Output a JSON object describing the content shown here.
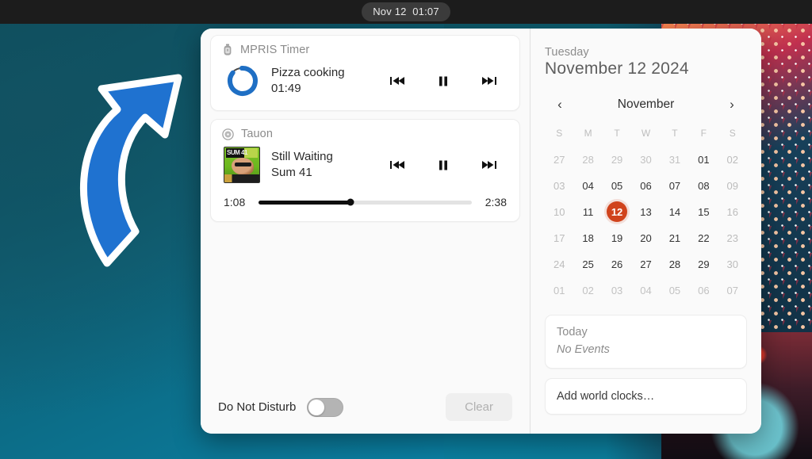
{
  "topbar": {
    "clock": "Nov 12  01:07"
  },
  "notifications": {
    "groups": [
      {
        "app_name": "MPRIS Timer",
        "app_icon": "stopwatch-icon",
        "thumb": "timer-ring",
        "title": "Pizza cooking",
        "subtitle": "01:49",
        "controls": [
          {
            "name": "previous",
            "glyph": "⏮"
          },
          {
            "name": "pause",
            "glyph": "⏸"
          },
          {
            "name": "next",
            "glyph": "⏭"
          }
        ],
        "ring_progress_percent": 72,
        "ring_color": "#1f6fc4"
      },
      {
        "app_name": "Tauon",
        "app_icon": "disc-icon",
        "thumb": "album-art",
        "title": "Still Waiting",
        "subtitle": "Sum 41",
        "album_art_text": "SUM 41",
        "controls": [
          {
            "name": "previous",
            "glyph": "⏮"
          },
          {
            "name": "pause",
            "glyph": "⏸"
          },
          {
            "name": "next",
            "glyph": "⏭"
          }
        ],
        "seek": {
          "elapsed": "1:08",
          "total": "2:38",
          "progress_percent": 43
        }
      }
    ]
  },
  "footer": {
    "dnd_label": "Do Not Disturb",
    "dnd_on": false,
    "clear_label": "Clear"
  },
  "calendar": {
    "weekday": "Tuesday",
    "full_date": "November 12 2024",
    "month_label": "November",
    "prev_glyph": "‹",
    "next_glyph": "›",
    "dow_labels": [
      "S",
      "M",
      "T",
      "W",
      "T",
      "F",
      "S"
    ],
    "weeks": [
      [
        {
          "n": "27",
          "state": "dim"
        },
        {
          "n": "28",
          "state": "dim"
        },
        {
          "n": "29",
          "state": "dim"
        },
        {
          "n": "30",
          "state": "dim"
        },
        {
          "n": "31",
          "state": "dim"
        },
        {
          "n": "01",
          "state": "normal"
        },
        {
          "n": "02",
          "state": "weekend"
        }
      ],
      [
        {
          "n": "03",
          "state": "weekend"
        },
        {
          "n": "04",
          "state": "normal"
        },
        {
          "n": "05",
          "state": "normal"
        },
        {
          "n": "06",
          "state": "normal"
        },
        {
          "n": "07",
          "state": "normal"
        },
        {
          "n": "08",
          "state": "normal"
        },
        {
          "n": "09",
          "state": "weekend"
        }
      ],
      [
        {
          "n": "10",
          "state": "weekend"
        },
        {
          "n": "11",
          "state": "normal"
        },
        {
          "n": "12",
          "state": "today"
        },
        {
          "n": "13",
          "state": "normal"
        },
        {
          "n": "14",
          "state": "normal"
        },
        {
          "n": "15",
          "state": "normal"
        },
        {
          "n": "16",
          "state": "weekend"
        }
      ],
      [
        {
          "n": "17",
          "state": "weekend"
        },
        {
          "n": "18",
          "state": "normal"
        },
        {
          "n": "19",
          "state": "normal"
        },
        {
          "n": "20",
          "state": "normal"
        },
        {
          "n": "21",
          "state": "normal"
        },
        {
          "n": "22",
          "state": "normal"
        },
        {
          "n": "23",
          "state": "weekend"
        }
      ],
      [
        {
          "n": "24",
          "state": "weekend"
        },
        {
          "n": "25",
          "state": "normal"
        },
        {
          "n": "26",
          "state": "normal"
        },
        {
          "n": "27",
          "state": "normal"
        },
        {
          "n": "28",
          "state": "normal"
        },
        {
          "n": "29",
          "state": "normal"
        },
        {
          "n": "30",
          "state": "weekend"
        }
      ],
      [
        {
          "n": "01",
          "state": "dim"
        },
        {
          "n": "02",
          "state": "dim"
        },
        {
          "n": "03",
          "state": "dim"
        },
        {
          "n": "04",
          "state": "dim"
        },
        {
          "n": "05",
          "state": "dim"
        },
        {
          "n": "06",
          "state": "dim"
        },
        {
          "n": "07",
          "state": "dim"
        }
      ]
    ],
    "today_highlight_color": "#d0431c"
  },
  "events": {
    "title": "Today",
    "empty_text": "No Events"
  },
  "world_clocks": {
    "label": "Add world clocks…"
  },
  "annotation": {
    "shape": "curved-arrow",
    "color": "#1f72d0",
    "outline": "#ffffff",
    "points_to": "MPRIS Timer notification"
  }
}
